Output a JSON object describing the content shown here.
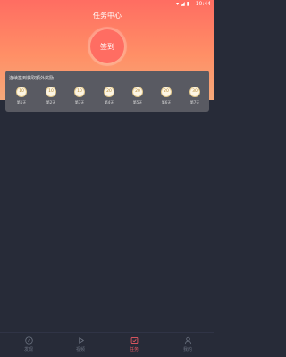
{
  "status_bar": {
    "time": "10:44",
    "icons": "▾◢▮"
  },
  "header": {
    "title": "任务中心"
  },
  "checkin": {
    "button_label": "签到"
  },
  "reward": {
    "title": "连续签到获取额外奖励",
    "days": [
      {
        "amount": "10",
        "label": "第1天"
      },
      {
        "amount": "10",
        "label": "第2天"
      },
      {
        "amount": "10",
        "label": "第3天"
      },
      {
        "amount": "20",
        "label": "第4天"
      },
      {
        "amount": "20",
        "label": "第5天"
      },
      {
        "amount": "20",
        "label": "第6天"
      },
      {
        "amount": "30",
        "label": "第7天"
      }
    ]
  },
  "tabs": [
    {
      "label": "发现",
      "icon": "compass-icon"
    },
    {
      "label": "视频",
      "icon": "play-icon"
    },
    {
      "label": "任务",
      "icon": "task-icon"
    },
    {
      "label": "我的",
      "icon": "person-icon"
    }
  ],
  "colors": {
    "accent": "#f05a63",
    "background": "#272b38",
    "card": "#595a62"
  }
}
